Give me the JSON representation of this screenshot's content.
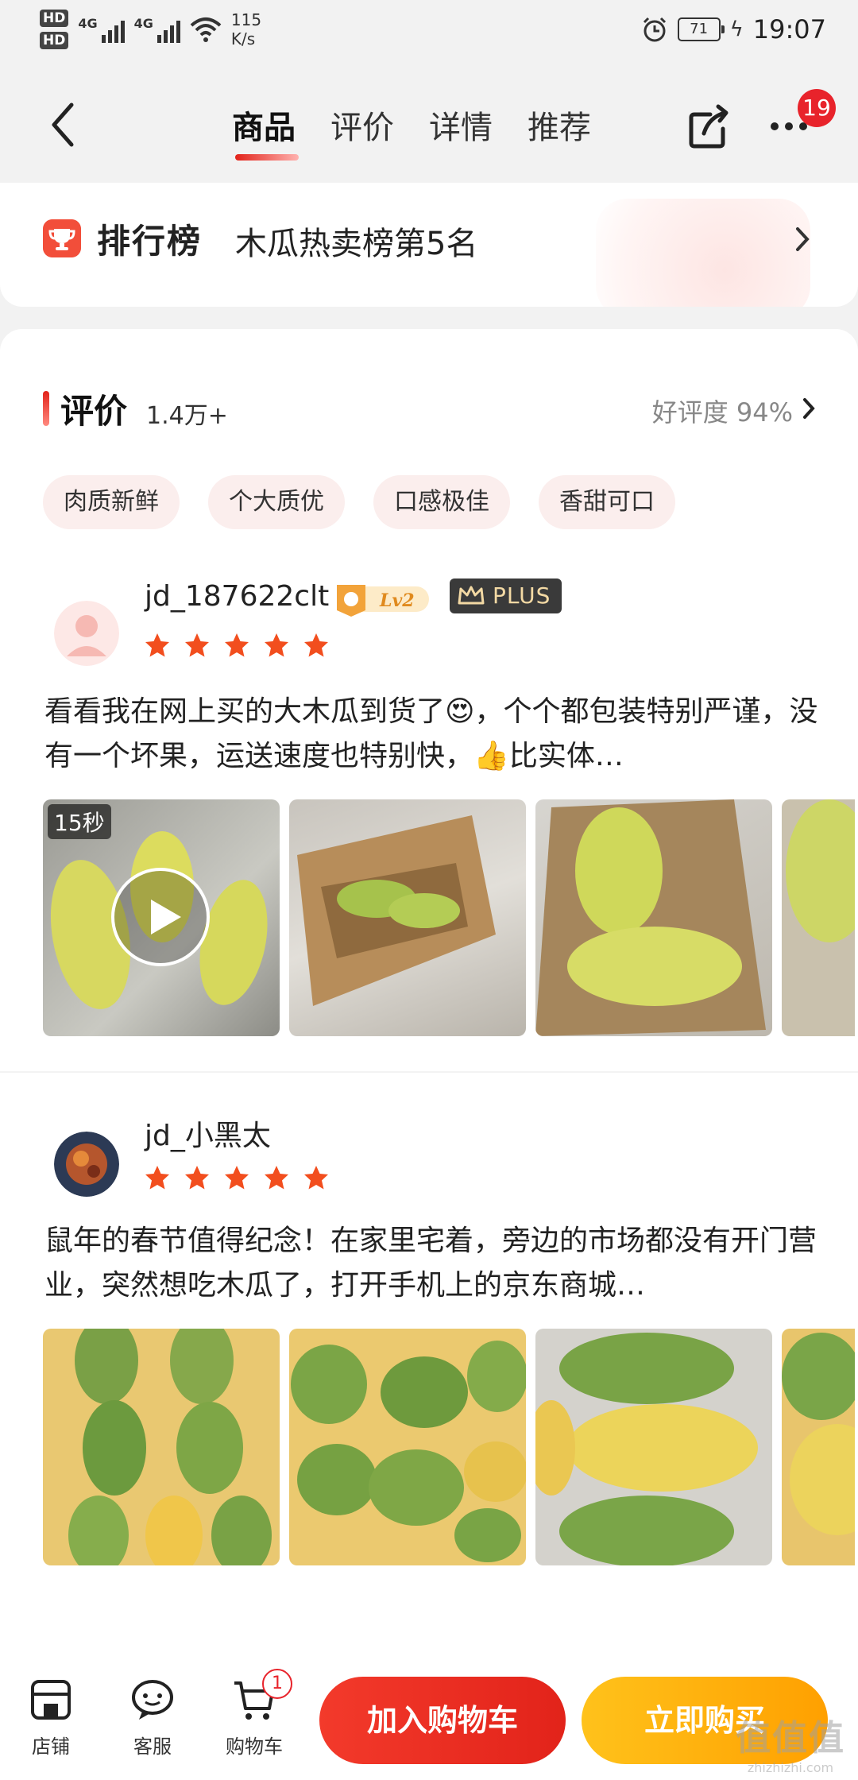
{
  "status_bar": {
    "hd1": "HD",
    "hd2": "HD",
    "net1": "4G",
    "net2": "4G",
    "speed": "115",
    "speed_unit": "K/s",
    "battery": "71",
    "time": "19:07"
  },
  "nav": {
    "tabs": [
      "商品",
      "评价",
      "详情",
      "推荐"
    ],
    "more_badge": "19"
  },
  "ranking": {
    "title": "排行榜",
    "text": "木瓜热卖榜第5名"
  },
  "reviews_section": {
    "title": "评价",
    "count": "1.4万+",
    "rate": "好评度 94%",
    "tags": [
      "肉质新鲜",
      "个大质优",
      "口感极佳",
      "香甜可口"
    ]
  },
  "reviews": [
    {
      "user": "jd_187622clt",
      "level": "Lv2",
      "plus": "PLUS",
      "stars": 5,
      "text": "看看我在网上买的大木瓜到货了😍，个个都包装特别严谨，没有一个坏果，运送速度也特别快，👍比实体…",
      "video_length": "15秒"
    },
    {
      "user": "jd_小黑太",
      "stars": 5,
      "text": "鼠年的春节值得纪念！在家里宅着，旁边的市场都没有开门营业，突然想吃木瓜了，打开手机上的京东商城…"
    }
  ],
  "bottom_bar": {
    "shop": "店铺",
    "service": "客服",
    "cart": "购物车",
    "cart_badge": "1",
    "add_to_cart": "加入购物车",
    "buy_now": "立即购买",
    "watermark": "值值值",
    "watermark_small": "zhizhizhi.com"
  },
  "colors": {
    "brand_red": "#e2231a",
    "buy_orange": "#ffa000"
  }
}
